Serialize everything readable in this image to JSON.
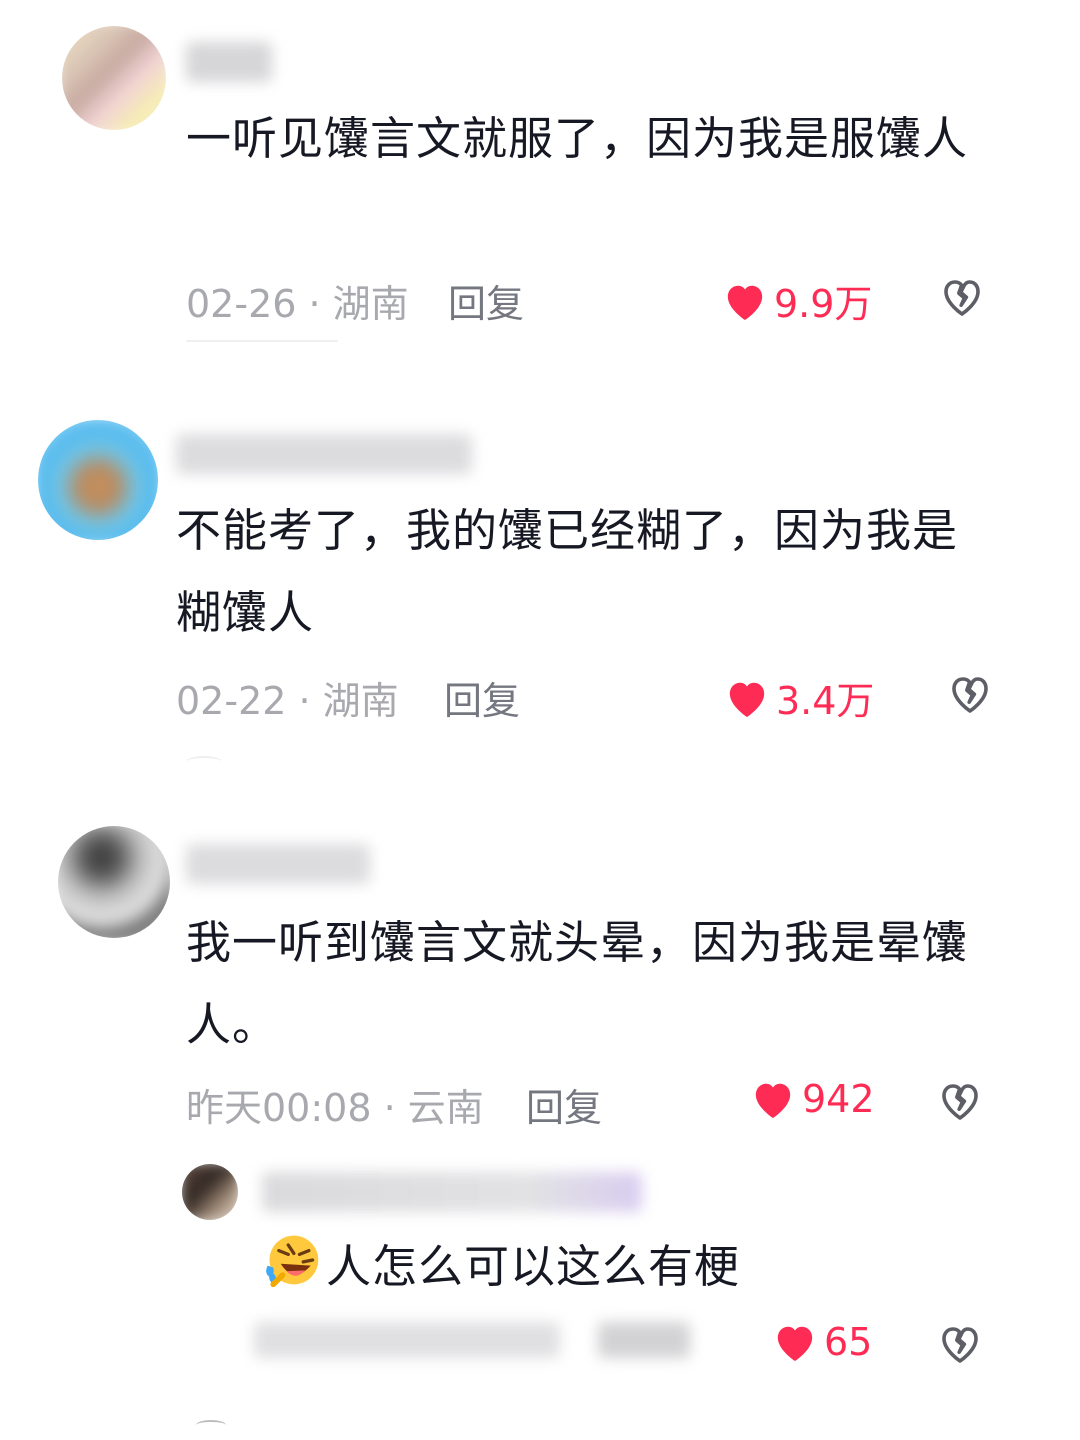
{
  "comments": [
    {
      "text": "一听见馕言文就服了，因为我是服馕人",
      "meta": "02-26 · 湖南",
      "reply_label": "回复",
      "likes": "9.9万"
    },
    {
      "text": "不能考了，我的馕已经糊了，因为我是糊馕人",
      "meta": "02-22 · 湖南",
      "reply_label": "回复",
      "likes": "3.4万"
    },
    {
      "text": "我一听到馕言文就头晕，因为我是晕馕人。",
      "meta": "昨天00:08 · 云南",
      "reply_label": "回复",
      "likes": "942"
    }
  ],
  "reply": {
    "text": "人怎么可以这么有梗",
    "emoji_icon": "laughing-crying-emoji-icon",
    "likes": "65"
  },
  "colors": {
    "like_red": "#fe2c55",
    "meta_gray": "#a8a9ae",
    "text_dark": "#161823"
  },
  "icons": {
    "like": "heart-icon",
    "dislike": "broken-heart-icon"
  }
}
